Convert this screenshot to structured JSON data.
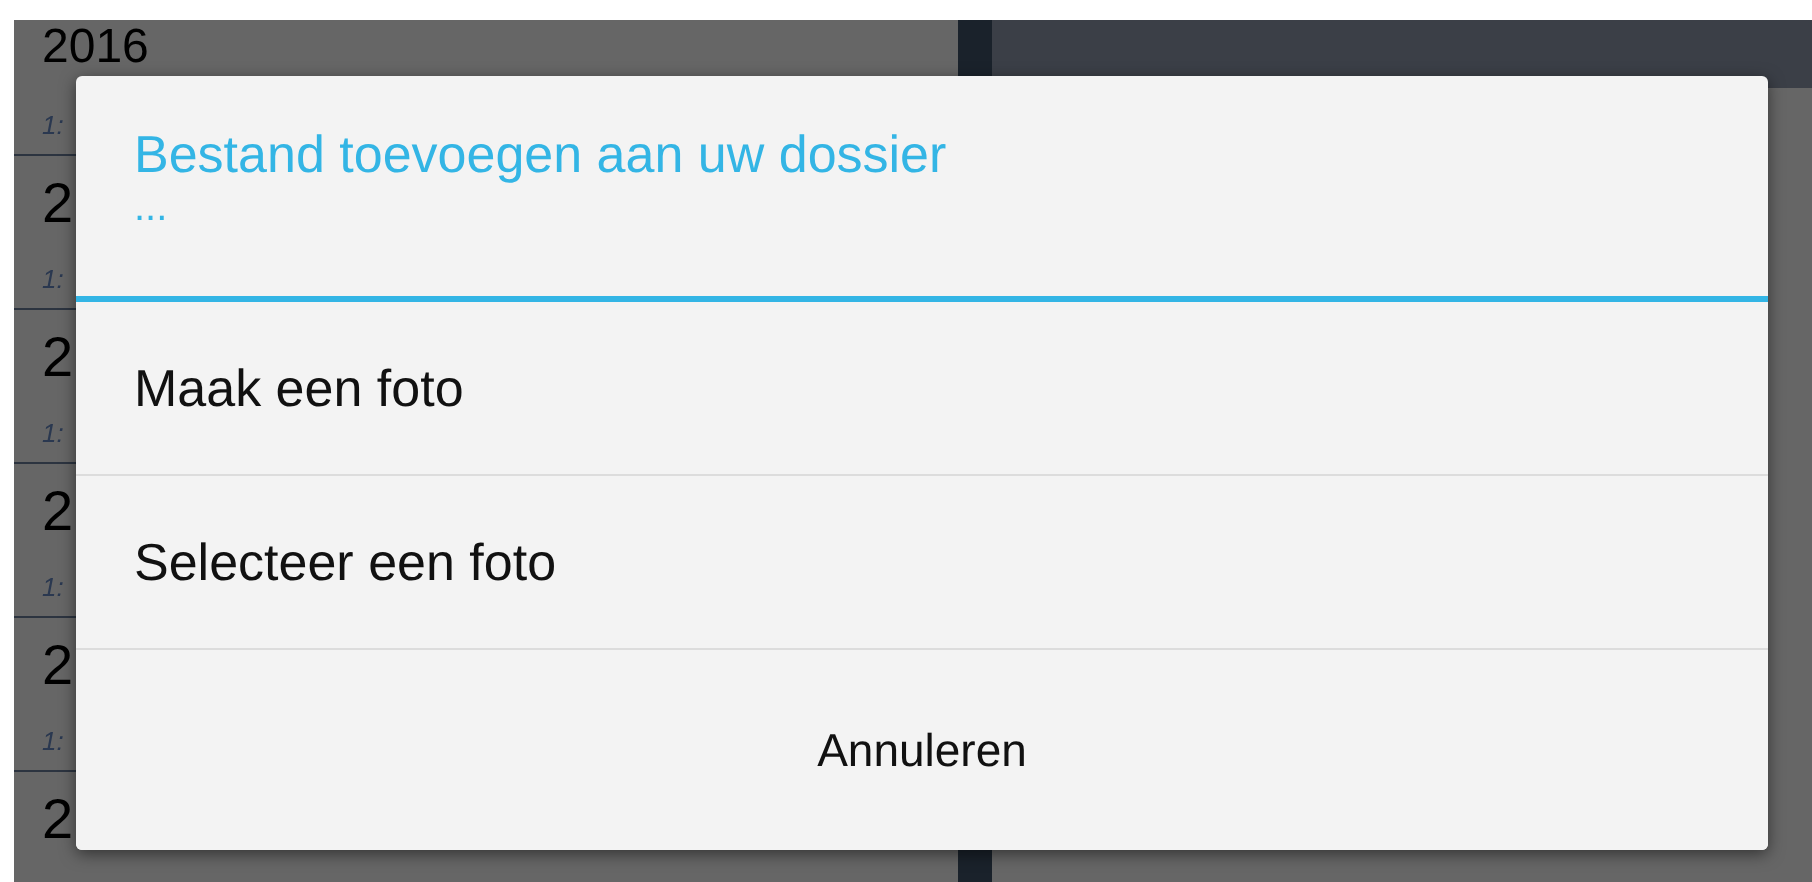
{
  "background_list": [
    {
      "year": "2016",
      "date": "1:"
    },
    {
      "year": "2",
      "date": "1:"
    },
    {
      "year": "2",
      "date": "1:"
    },
    {
      "year": "2",
      "date": "1:"
    },
    {
      "year": "2",
      "date": "1:"
    },
    {
      "year": "2"
    }
  ],
  "dialog": {
    "title": "Bestand toevoegen aan uw dossier",
    "subtitle": "...",
    "options": [
      {
        "label": "Maak een foto"
      },
      {
        "label": "Selecteer een foto"
      }
    ],
    "cancel_button": "Annuleren"
  }
}
